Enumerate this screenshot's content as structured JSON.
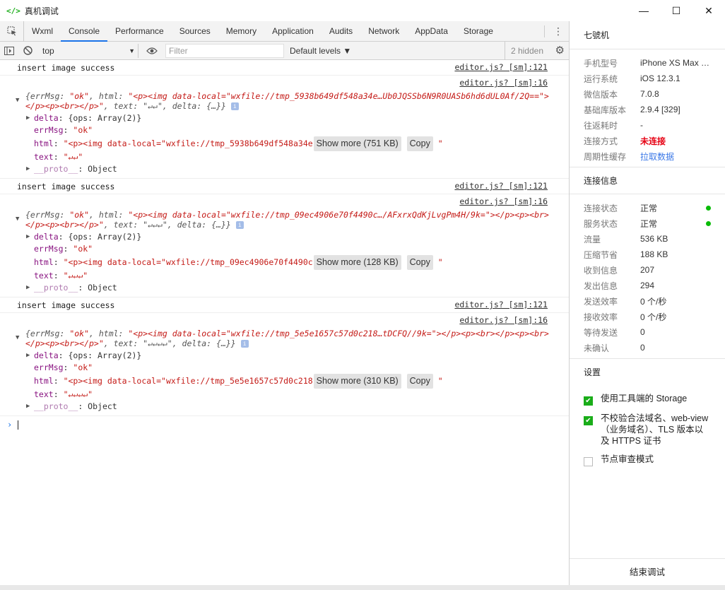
{
  "window": {
    "title": "真机调试",
    "icon": "code-brackets-icon"
  },
  "tabs": [
    "Wxml",
    "Console",
    "Performance",
    "Sources",
    "Memory",
    "Application",
    "Audits",
    "Network",
    "AppData",
    "Storage"
  ],
  "toolbar": {
    "context": "top",
    "filter_placeholder": "Filter",
    "levels": "Default levels ▼",
    "hidden": "2 hidden"
  },
  "console": [
    {
      "message": "insert image success",
      "msg_src": "editor.js? [sm]:121",
      "obj_src": "editor.js? [sm]:16",
      "head_pre": "{errMsg: ",
      "head_ok": "\"ok\"",
      "head_html_key": ", html: ",
      "head_html": "\"<p><img data-local=\"wxfile://tmp_5938b649df548a34e…Ub0JQSSb6N9R0UASb6hd6dUL0Af/2Q==\"></p><p><br></p>\"",
      "head_text": ", text: \"↵↵\", delta: {…}}",
      "delta": "{ops: Array(2)}",
      "errMsg": "\"ok\"",
      "html": "\"<p><img data-local=\"wxfile://tmp_5938b649df548a34e",
      "show_more": "Show more (751 KB)",
      "copy": "Copy",
      "text": "\"↵↵\"",
      "proto": "Object"
    },
    {
      "message": "insert image success",
      "msg_src": "editor.js? [sm]:121",
      "obj_src": "editor.js? [sm]:16",
      "head_pre": "{errMsg: ",
      "head_ok": "\"ok\"",
      "head_html_key": ", html: ",
      "head_html": "\"<p><img data-local=\"wxfile://tmp_09ec4906e70f4490c…/AFxrxQdKjLvgPm4H/9k=\"></p><p><br></p><p><br></p>\"",
      "head_text": ", text: \"↵↵↵\", delta: {…}}",
      "delta": "{ops: Array(2)}",
      "errMsg": "\"ok\"",
      "html": "\"<p><img data-local=\"wxfile://tmp_09ec4906e70f4490c",
      "show_more": "Show more (128 KB)",
      "copy": "Copy",
      "text": "\"↵↵↵\"",
      "proto": "Object"
    },
    {
      "message": "insert image success",
      "msg_src": "editor.js? [sm]:121",
      "obj_src": "editor.js? [sm]:16",
      "head_pre": "{errMsg: ",
      "head_ok": "\"ok\"",
      "head_html_key": ", html: ",
      "head_html": "\"<p><img data-local=\"wxfile://tmp_5e5e1657c57d0c218…tDCFQ//9k=\"></p><p><br></p><p><br></p><p><br></p>\"",
      "head_text": ", text: \"↵↵↵↵\", delta: {…}}",
      "delta": "{ops: Array(2)}",
      "errMsg": "\"ok\"",
      "html": "\"<p><img data-local=\"wxfile://tmp_5e5e1657c57d0c218",
      "show_more": "Show more (310 KB)",
      "copy": "Copy",
      "text": "\"↵↵↵↵\"",
      "proto": "Object"
    }
  ],
  "panel": {
    "device": "七號机",
    "info": [
      {
        "k": "手机型号",
        "v": "iPhone XS Max C..."
      },
      {
        "k": "运行系统",
        "v": "iOS 12.3.1"
      },
      {
        "k": "微信版本",
        "v": "7.0.8"
      },
      {
        "k": "基础库版本",
        "v": "2.9.4 [329]"
      },
      {
        "k": "往返耗时",
        "v": "-"
      },
      {
        "k": "连接方式",
        "v": "未连接"
      },
      {
        "k": "周期性缓存",
        "v": "拉取数据"
      }
    ],
    "conn_title": "连接信息",
    "conn": [
      {
        "k": "连接状态",
        "v": "正常"
      },
      {
        "k": "服务状态",
        "v": "正常"
      },
      {
        "k": "流量",
        "v": "536 KB"
      },
      {
        "k": "压缩节省",
        "v": "188 KB"
      },
      {
        "k": "收到信息",
        "v": "207"
      },
      {
        "k": "发出信息",
        "v": "294"
      },
      {
        "k": "发送效率",
        "v": "0 个/秒"
      },
      {
        "k": "接收效率",
        "v": "0 个/秒"
      },
      {
        "k": "等待发送",
        "v": "0"
      },
      {
        "k": "未确认",
        "v": "0"
      }
    ],
    "settings_title": "设置",
    "settings": [
      {
        "label": "使用工具端的 Storage",
        "checked": true
      },
      {
        "label": "不校验合法域名、web-view（业务域名）、TLS 版本以及 HTTPS 证书",
        "checked": true
      },
      {
        "label": "节点审查模式",
        "checked": false
      }
    ],
    "end_button": "结束调试"
  },
  "colors": {
    "accent": "#1aad19",
    "tab_underline": "#1a73e8",
    "error_red": "#e60012",
    "link": "#3b78e7"
  }
}
